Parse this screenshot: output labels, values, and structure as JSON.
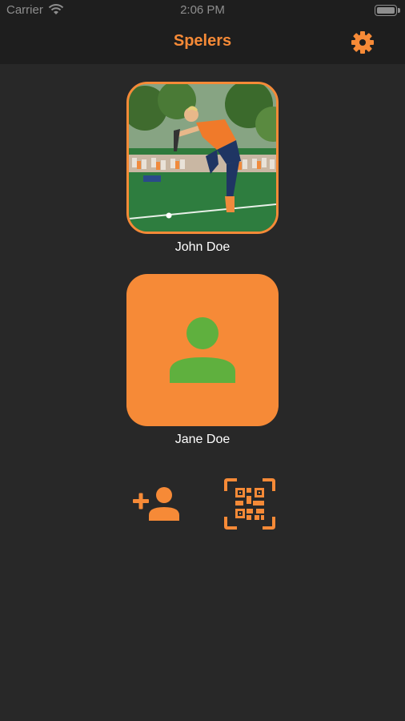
{
  "status_bar": {
    "carrier": "Carrier",
    "time": "2:06 PM"
  },
  "nav": {
    "title": "Spelers",
    "settings_icon": "gear-icon"
  },
  "players": [
    {
      "name": "John Doe",
      "avatar": "photo"
    },
    {
      "name": "Jane Doe",
      "avatar": "person-placeholder-icon"
    }
  ],
  "actions": {
    "add_player_icon": "add-person-icon",
    "scan_icon": "qr-scan-icon"
  },
  "colors": {
    "accent": "#f68a37",
    "background": "#282828",
    "nav_background": "#1e1e1e",
    "placeholder_figure": "#5fb03e"
  }
}
